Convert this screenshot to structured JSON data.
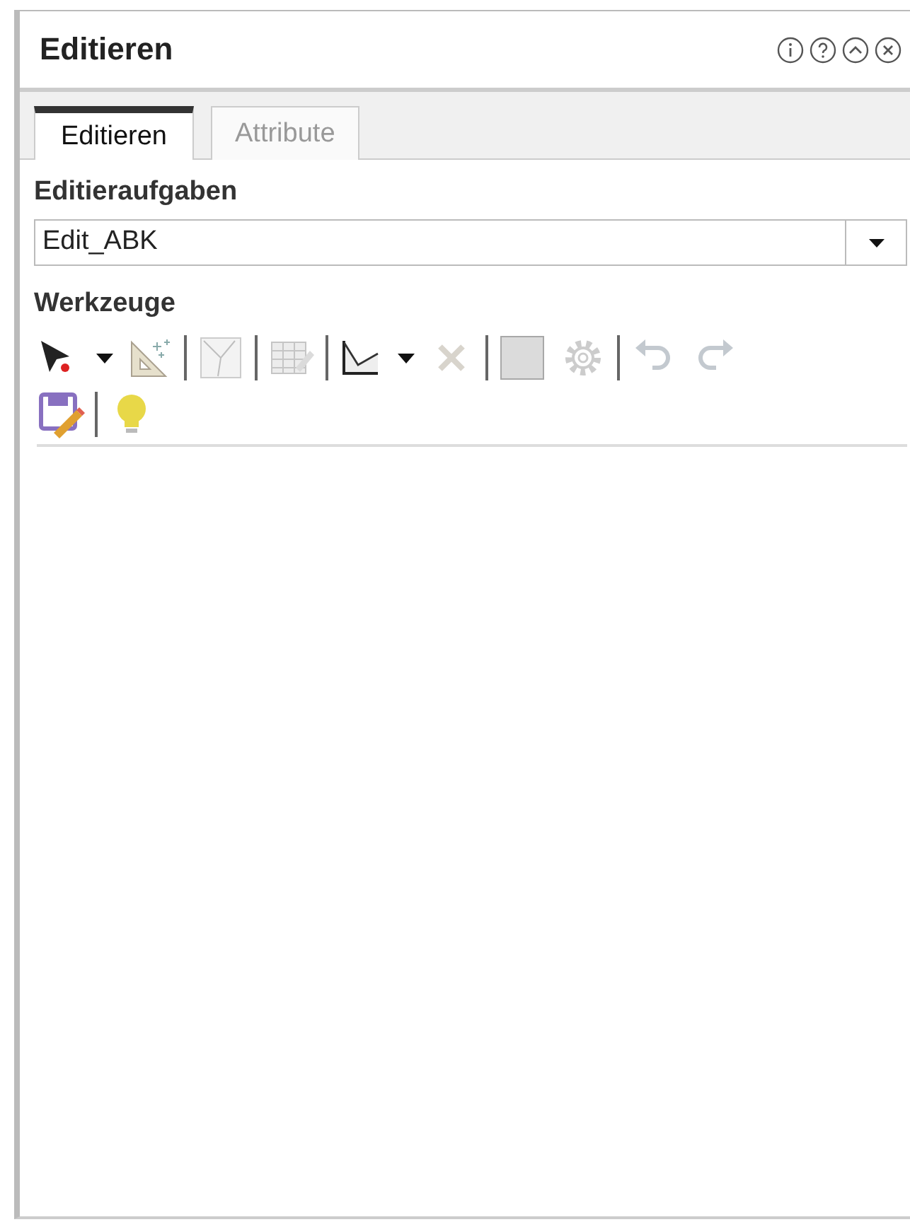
{
  "panel": {
    "title": "Editieren"
  },
  "tabs": [
    {
      "label": "Editieren",
      "selected": true
    },
    {
      "label": "Attribute",
      "selected": false
    }
  ],
  "task_label": "Editieraufgaben",
  "task_select": {
    "value": "Edit_ABK"
  },
  "tools_label": "Werkzeuge",
  "toolbar_rows": [
    [
      {
        "kind": "pointer",
        "disabled": false,
        "dropdown": true
      },
      {
        "kind": "construct",
        "disabled": false,
        "dropdown": false
      },
      {
        "kind": "separator"
      },
      {
        "kind": "split",
        "disabled": true,
        "dropdown": false
      },
      {
        "kind": "separator"
      },
      {
        "kind": "table",
        "disabled": true,
        "dropdown": false
      },
      {
        "kind": "separator"
      },
      {
        "kind": "reshape",
        "disabled": false,
        "dropdown": true
      },
      {
        "kind": "delete",
        "disabled": true,
        "dropdown": false
      },
      {
        "kind": "separator"
      },
      {
        "kind": "square",
        "disabled": true,
        "dropdown": false
      },
      {
        "kind": "gear",
        "disabled": true,
        "dropdown": false
      },
      {
        "kind": "separator"
      },
      {
        "kind": "undo",
        "disabled": true,
        "dropdown": false
      },
      {
        "kind": "redo",
        "disabled": true,
        "dropdown": false
      }
    ],
    [
      {
        "kind": "save",
        "disabled": false,
        "dropdown": false
      },
      {
        "kind": "separator"
      },
      {
        "kind": "bulb",
        "disabled": false,
        "dropdown": false
      }
    ]
  ]
}
